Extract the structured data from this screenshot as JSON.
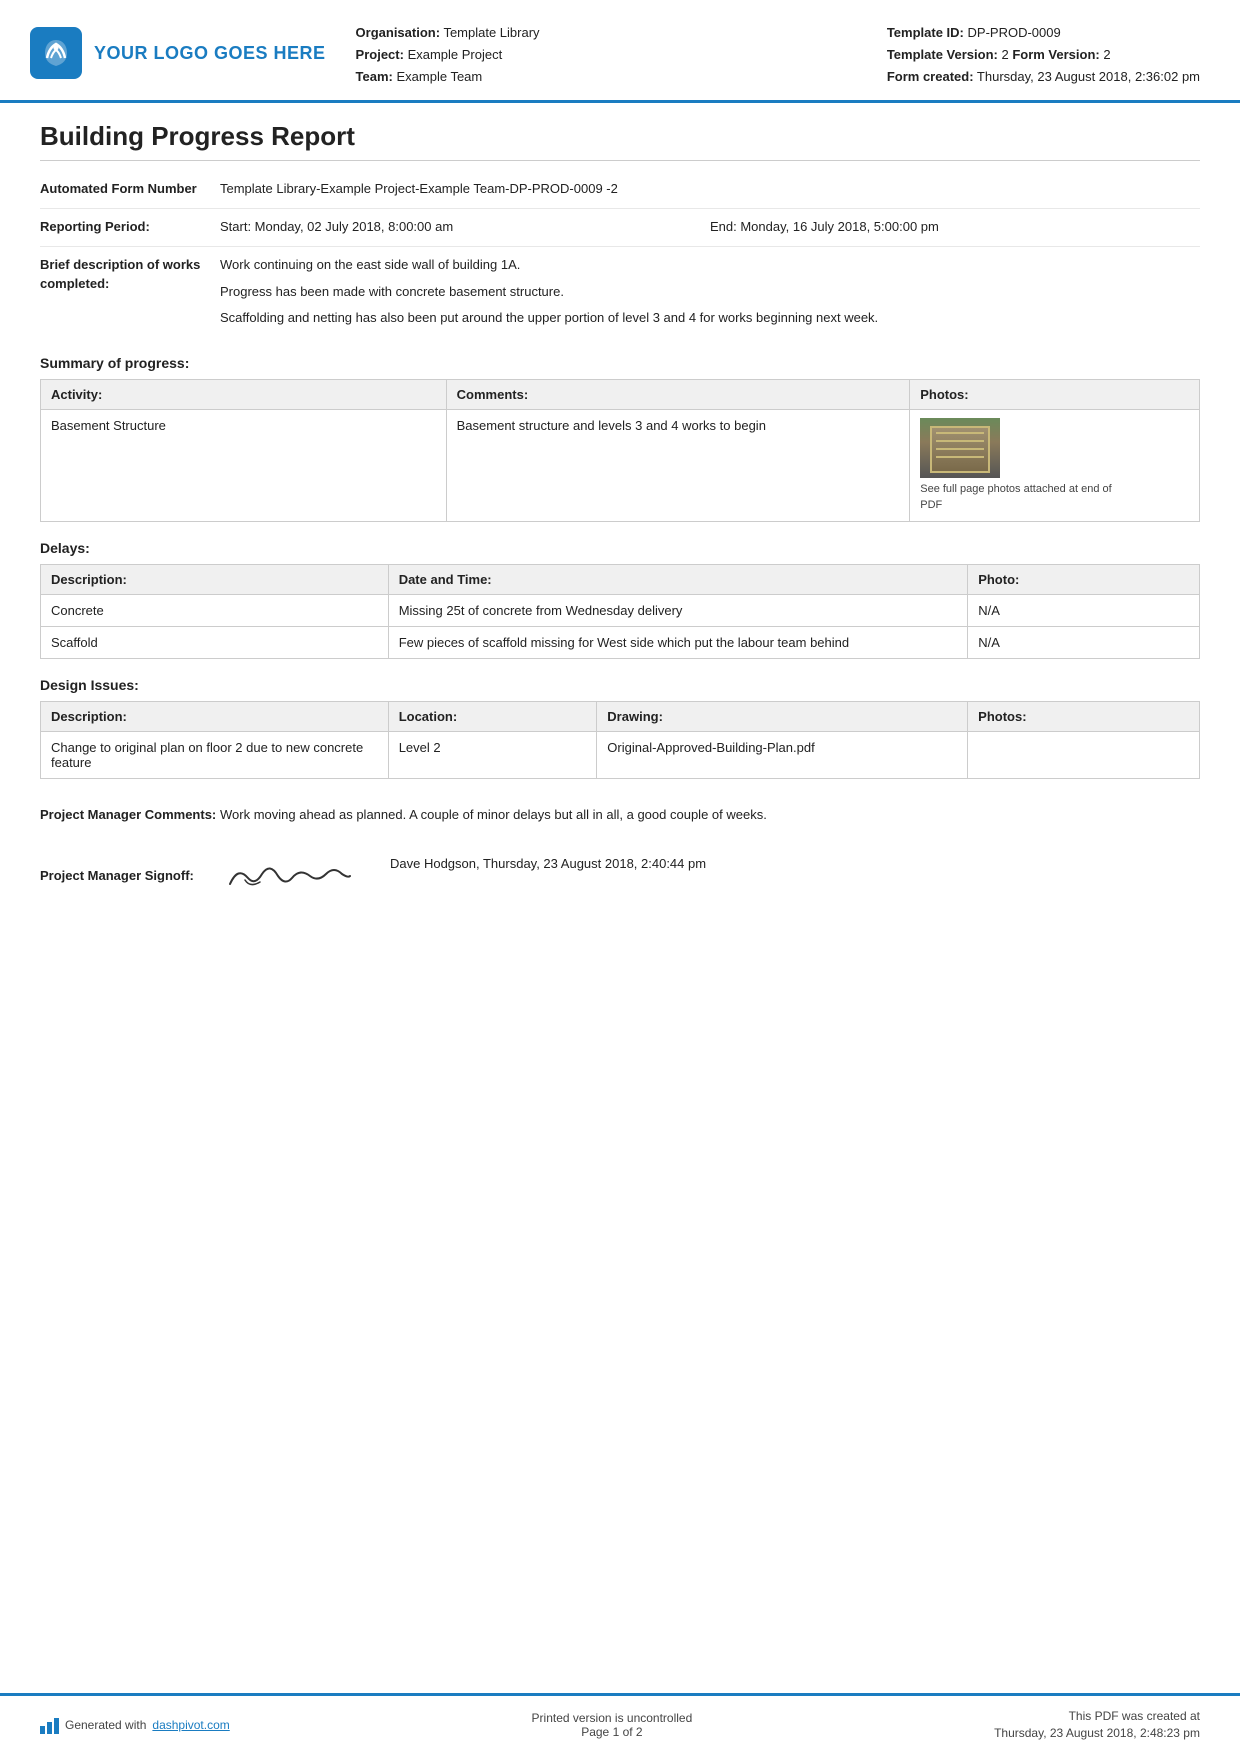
{
  "header": {
    "logo_text": "YOUR LOGO GOES HERE",
    "organisation_label": "Organisation:",
    "organisation_value": "Template Library",
    "project_label": "Project:",
    "project_value": "Example Project",
    "team_label": "Team:",
    "team_value": "Example Team",
    "template_id_label": "Template ID:",
    "template_id_value": "DP-PROD-0009",
    "template_version_label": "Template Version:",
    "template_version_value": "2",
    "form_version_label": "Form Version:",
    "form_version_value": "2",
    "form_created_label": "Form created:",
    "form_created_value": "Thursday, 23 August 2018, 2:36:02 pm"
  },
  "report": {
    "title": "Building Progress Report",
    "automated_form_number_label": "Automated Form Number",
    "automated_form_number_value": "Template Library-Example Project-Example Team-DP-PROD-0009   -2",
    "reporting_period_label": "Reporting Period:",
    "reporting_period_start": "Start: Monday, 02 July 2018, 8:00:00 am",
    "reporting_period_end": "End: Monday, 16 July 2018, 5:00:00 pm",
    "brief_description_label": "Brief description of works completed:",
    "brief_description_lines": [
      "Work continuing on the east side wall of building 1A.",
      "Progress has been made with concrete basement structure.",
      "Scaffolding and netting has also been put around the upper portion of level 3 and 4 for works beginning next week."
    ]
  },
  "summary": {
    "heading": "Summary of progress:",
    "table": {
      "headers": [
        "Activity:",
        "Comments:",
        "Photos:"
      ],
      "rows": [
        {
          "activity": "Basement Structure",
          "comments": "Basement structure and levels 3 and 4 works to begin",
          "photo_caption": "See full page photos attached at end of PDF"
        }
      ]
    }
  },
  "delays": {
    "heading": "Delays:",
    "table": {
      "headers": [
        "Description:",
        "Date and Time:",
        "Photo:"
      ],
      "rows": [
        {
          "description": "Concrete",
          "date_time": "Missing 25t of concrete from Wednesday delivery",
          "photo": "N/A"
        },
        {
          "description": "Scaffold",
          "date_time": "Few pieces of scaffold missing for West side which put the labour team behind",
          "photo": "N/A"
        }
      ]
    }
  },
  "design_issues": {
    "heading": "Design Issues:",
    "table": {
      "headers": [
        "Description:",
        "Location:",
        "Drawing:",
        "Photos:"
      ],
      "rows": [
        {
          "description": "Change to original plan on floor 2 due to new concrete feature",
          "location": "Level 2",
          "drawing": "Original-Approved-Building-Plan.pdf",
          "photo": ""
        }
      ]
    }
  },
  "project_manager": {
    "comments_label": "Project Manager Comments:",
    "comments_value": "Work moving ahead as planned. A couple of minor delays but all in all, a good couple of weeks.",
    "signoff_label": "Project Manager Signoff:",
    "signoff_name": "Dave Hodgson, Thursday, 23 August 2018, 2:40:44 pm"
  },
  "footer": {
    "generated_text": "Generated with",
    "dashpivot_link": "dashpivot.com",
    "uncontrolled_text": "Printed version is uncontrolled",
    "page_text": "Page 1",
    "of_text": "of 2",
    "pdf_created_text": "This PDF was created at",
    "pdf_created_date": "Thursday, 23 August 2018, 2:48:23 pm"
  }
}
